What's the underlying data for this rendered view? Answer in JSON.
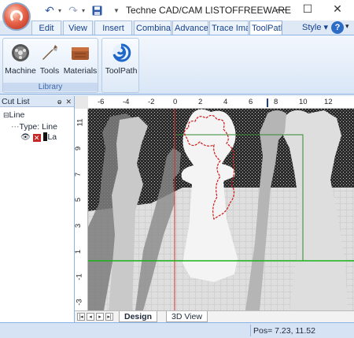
{
  "window": {
    "title": "Techne CAD/CAM  LISTOFFREEWARE",
    "controls": {
      "minimize": "—",
      "maximize": "☐",
      "close": "✕"
    }
  },
  "quick_access": {
    "undo": "↶",
    "redo": "↷",
    "save": "💾",
    "customize": "▼"
  },
  "tabs": [
    {
      "label": "Edit"
    },
    {
      "label": "View"
    },
    {
      "label": "Insert"
    },
    {
      "label": "Combinat"
    },
    {
      "label": "Advanced"
    },
    {
      "label": "Trace Imag"
    },
    {
      "label": "ToolPath"
    }
  ],
  "style_menu": "Style",
  "help_button": "?",
  "ribbon": {
    "library_group": {
      "label": "Library",
      "buttons": [
        {
          "label": "Machine",
          "icon": "machine-icon"
        },
        {
          "label": "Tools",
          "icon": "tools-icon"
        },
        {
          "label": "Materials",
          "icon": "materials-icon"
        }
      ]
    },
    "toolpath_group": {
      "label": "",
      "buttons": [
        {
          "label": "ToolPath",
          "icon": "toolpath-icon"
        }
      ]
    }
  },
  "cut_list": {
    "title": "Cut List",
    "pin_icon": "pin-icon",
    "close_icon": "close-icon",
    "tree": {
      "root": {
        "expander": "⊟",
        "label": "Line"
      },
      "type_label": "Type: Line",
      "layer_label": "La"
    }
  },
  "rulers": {
    "h_ticks": [
      "-6",
      "-4",
      "-2",
      "0",
      "2",
      "4",
      "6",
      "8",
      "10",
      "12"
    ],
    "v_ticks": [
      "11",
      "9",
      "7",
      "5",
      "3",
      "1",
      "-1",
      "-3"
    ]
  },
  "doc_tabs": [
    {
      "label": "Design",
      "active": true
    },
    {
      "label": "3D View",
      "active": false
    }
  ],
  "status": {
    "pos": "Pos= 7.23, 11.52"
  },
  "colors": {
    "accent": "#15428b",
    "ribbon_border": "#8db2e3",
    "origin_line": "#e03030",
    "x_axis_line": "#18b418",
    "toolpath": "#d01818",
    "grid_bg": "#2a2a2a"
  }
}
